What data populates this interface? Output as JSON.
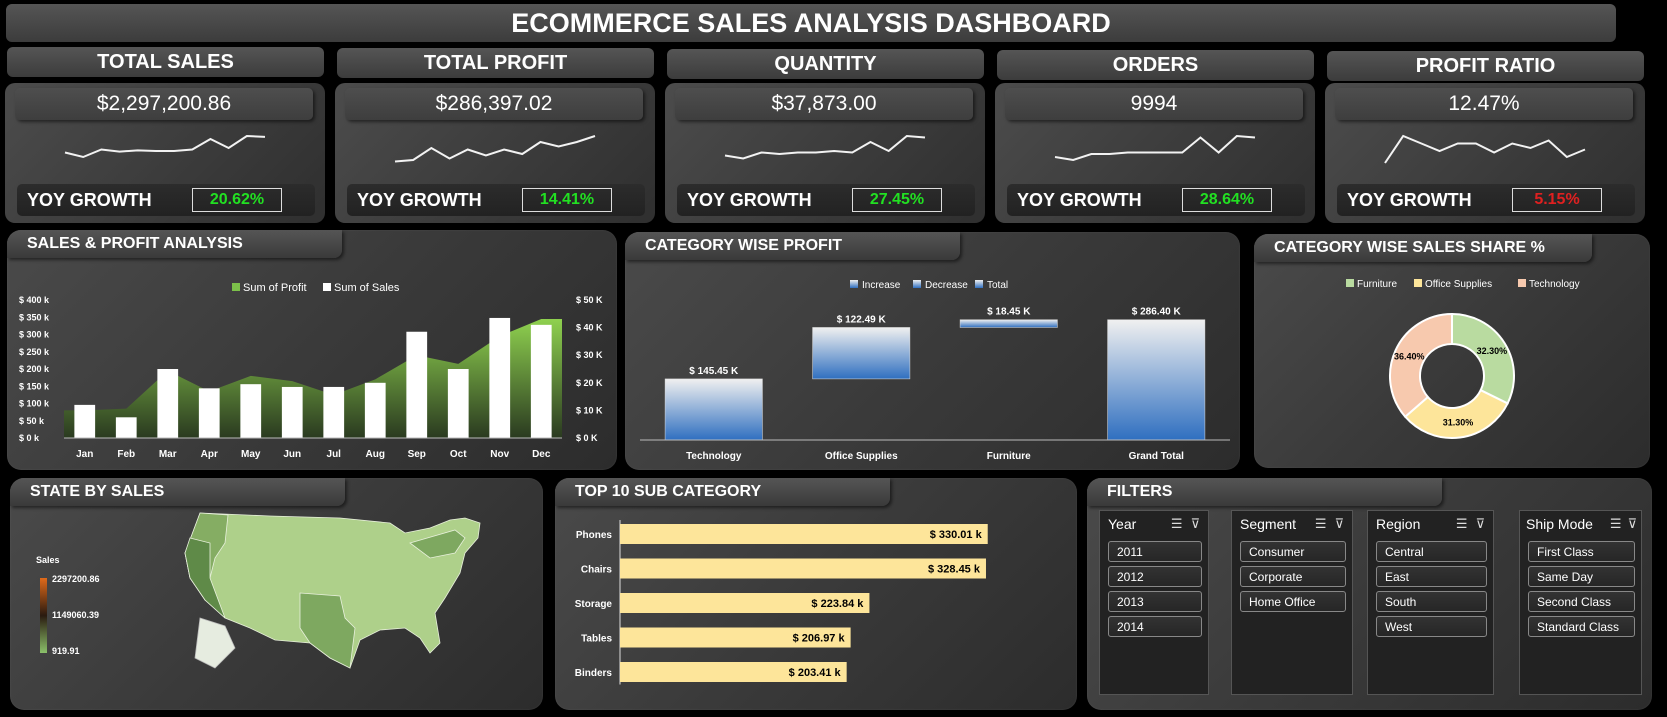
{
  "title": "ECOMMERCE SALES ANALYSIS DASHBOARD",
  "kpis": [
    {
      "label": "TOTAL SALES",
      "value": "$2,297,200.86",
      "yoy_label": "YOY GROWTH",
      "yoy": "20.62%",
      "yoy_color": "#22e022",
      "spark": [
        0.45,
        0.3,
        0.55,
        0.48,
        0.52,
        0.5,
        0.5,
        0.55,
        0.9,
        0.6,
        1.0,
        0.97
      ]
    },
    {
      "label": "TOTAL PROFIT",
      "value": "$286,397.02",
      "yoy_label": "YOY GROWTH",
      "yoy": "14.41%",
      "yoy_color": "#22e022",
      "spark": [
        0.15,
        0.2,
        0.6,
        0.25,
        0.55,
        0.35,
        0.55,
        0.4,
        0.8,
        0.65,
        0.8,
        1.0
      ]
    },
    {
      "label": "QUANTITY",
      "value": "$37,873.00",
      "yoy_label": "YOY GROWTH",
      "yoy": "27.45%",
      "yoy_color": "#22e022",
      "spark": [
        0.35,
        0.25,
        0.45,
        0.4,
        0.45,
        0.45,
        0.5,
        0.45,
        0.8,
        0.5,
        1.0,
        0.95
      ]
    },
    {
      "label": "ORDERS",
      "value": "9994",
      "yoy_label": "YOY GROWTH",
      "yoy": "28.64%",
      "yoy_color": "#22e022",
      "spark": [
        0.3,
        0.2,
        0.4,
        0.4,
        0.45,
        0.45,
        0.45,
        0.45,
        0.95,
        0.45,
        1.0,
        0.95
      ]
    },
    {
      "label": "PROFIT RATIO",
      "value": "12.47%",
      "yoy_label": "YOY GROWTH",
      "yoy": "5.15%",
      "yoy_color": "#e02020",
      "spark": [
        0.1,
        1.0,
        0.75,
        0.5,
        0.75,
        0.75,
        0.45,
        0.75,
        0.6,
        0.85,
        0.3,
        0.55
      ]
    }
  ],
  "panels": {
    "sales_profit": "SALES & PROFIT ANALYSIS",
    "category_profit": "CATEGORY WISE PROFIT",
    "category_share": "CATEGORY WISE SALES SHARE %",
    "state_sales": "STATE BY SALES",
    "top10": "TOP 10 SUB CATEGORY",
    "filters": "FILTERS"
  },
  "chart_data": [
    {
      "type": "bar",
      "title": "SALES & PROFIT ANALYSIS",
      "categories": [
        "Jan",
        "Feb",
        "Mar",
        "Apr",
        "May",
        "Jun",
        "Jul",
        "Aug",
        "Sep",
        "Oct",
        "Nov",
        "Dec"
      ],
      "series": [
        {
          "name": "Sum of Profit",
          "chart": "area",
          "axis": "left",
          "color": "#7cc04a",
          "values": [
            80,
            85,
            195,
            135,
            180,
            165,
            125,
            170,
            240,
            215,
            295,
            345
          ]
        },
        {
          "name": "Sum of Sales",
          "chart": "bar",
          "axis": "right",
          "color": "#ffffff",
          "values": [
            12,
            7.5,
            25,
            18,
            19.5,
            18.5,
            18.5,
            20,
            38.5,
            25,
            43.5,
            41
          ]
        }
      ],
      "y_left": {
        "ticks": [
          "$ 0 k",
          "$ 50 k",
          "$ 100 k",
          "$ 150 k",
          "$ 200 k",
          "$ 250 k",
          "$ 300 k",
          "$ 350 k",
          "$ 400 k"
        ],
        "range": [
          0,
          400
        ]
      },
      "y_right": {
        "ticks": [
          "$ 0 K",
          "$ 10 K",
          "$ 20 K",
          "$ 30 K",
          "$ 40 K",
          "$ 50 K"
        ],
        "range": [
          0,
          50
        ]
      },
      "legend": "top"
    },
    {
      "type": "bar",
      "subtype": "waterfall",
      "title": "CATEGORY WISE PROFIT",
      "legend_labels": [
        "Increase",
        "Decrease",
        "Total"
      ],
      "categories": [
        "Technology",
        "Office Supplies",
        "Furniture",
        "Grand Total"
      ],
      "values": [
        145.45,
        122.49,
        18.45,
        286.4
      ],
      "labels": [
        "$ 145.45 K",
        "$ 122.49 K",
        "$ 18.45 K",
        "$ 286.40 K"
      ],
      "legend": "top"
    },
    {
      "type": "pie",
      "subtype": "donut",
      "title": "CATEGORY WISE SALES SHARE %",
      "categories": [
        "Furniture",
        "Office Supplies",
        "Technology"
      ],
      "values": [
        32.3,
        31.3,
        36.4
      ],
      "labels": [
        "32.30%",
        "31.30%",
        "36.40%"
      ],
      "colors": [
        "#b9dba0",
        "#fde59a",
        "#f7c9ae"
      ],
      "legend": "top"
    },
    {
      "type": "bar",
      "orientation": "horizontal",
      "title": "TOP 10 SUB CATEGORY",
      "categories": [
        "Phones",
        "Chairs",
        "Storage",
        "Tables",
        "Binders"
      ],
      "values": [
        330.01,
        328.45,
        223.84,
        206.97,
        203.41
      ],
      "labels": [
        "$ 330.01 k",
        "$ 328.45 k",
        "$ 223.84 k",
        "$ 206.97 k",
        "$ 203.41 k"
      ],
      "color": "#fde59a"
    }
  ],
  "map": {
    "legend_title": "Sales",
    "legend_max": "2297200.86",
    "legend_mid": "1149060.39",
    "legend_min": "919.91"
  },
  "filters": [
    {
      "name": "Year",
      "items": [
        "2011",
        "2012",
        "2013",
        "2014"
      ]
    },
    {
      "name": "Segment",
      "items": [
        "Consumer",
        "Corporate",
        "Home Office"
      ]
    },
    {
      "name": "Region",
      "items": [
        "Central",
        "East",
        "South",
        "West"
      ]
    },
    {
      "name": "Ship Mode",
      "items": [
        "First Class",
        "Same Day",
        "Second Class",
        "Standard Class"
      ]
    }
  ]
}
